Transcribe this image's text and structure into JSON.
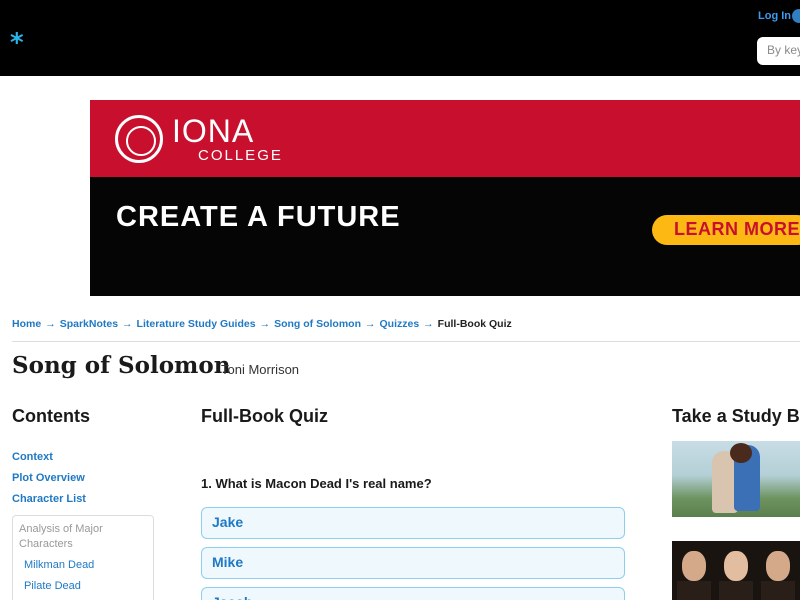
{
  "header": {
    "logo_symbol": "*",
    "login_label": "Log In",
    "search_placeholder": "By keyword"
  },
  "ad": {
    "brand_name": "IONA",
    "brand_sub": "COLLEGE",
    "headline": "CREATE A FUTURE",
    "cta_label": "LEARN MORE",
    "colors": {
      "red": "#c8102e",
      "black": "#050505",
      "cta": "#fdb813"
    }
  },
  "breadcrumb": {
    "items": [
      "Home",
      "SparkNotes",
      "Literature Study Guides",
      "Song of Solomon",
      "Quizzes"
    ],
    "separator": "→",
    "current": "Full-Book Quiz"
  },
  "book": {
    "title": "Song of Solomon",
    "author": "Toni Morrison"
  },
  "contents": {
    "heading": "Contents",
    "links": [
      "Context",
      "Plot Overview",
      "Character List"
    ],
    "box_title": "Analysis of Major Characters",
    "sub_links": [
      "Milkman Dead",
      "Pilate Dead"
    ]
  },
  "quiz": {
    "heading": "Full-Book Quiz",
    "question": "1. What is Macon Dead I's real name?",
    "answers": [
      "Jake",
      "Mike",
      "Jacob"
    ]
  },
  "sidebar_right": {
    "heading": "Take a Study Break"
  },
  "colors": {
    "link": "#1f79c4",
    "answer_bg": "#eef8fd",
    "answer_border": "#8dd0ee",
    "brand_accent": "#2ab3e6"
  }
}
